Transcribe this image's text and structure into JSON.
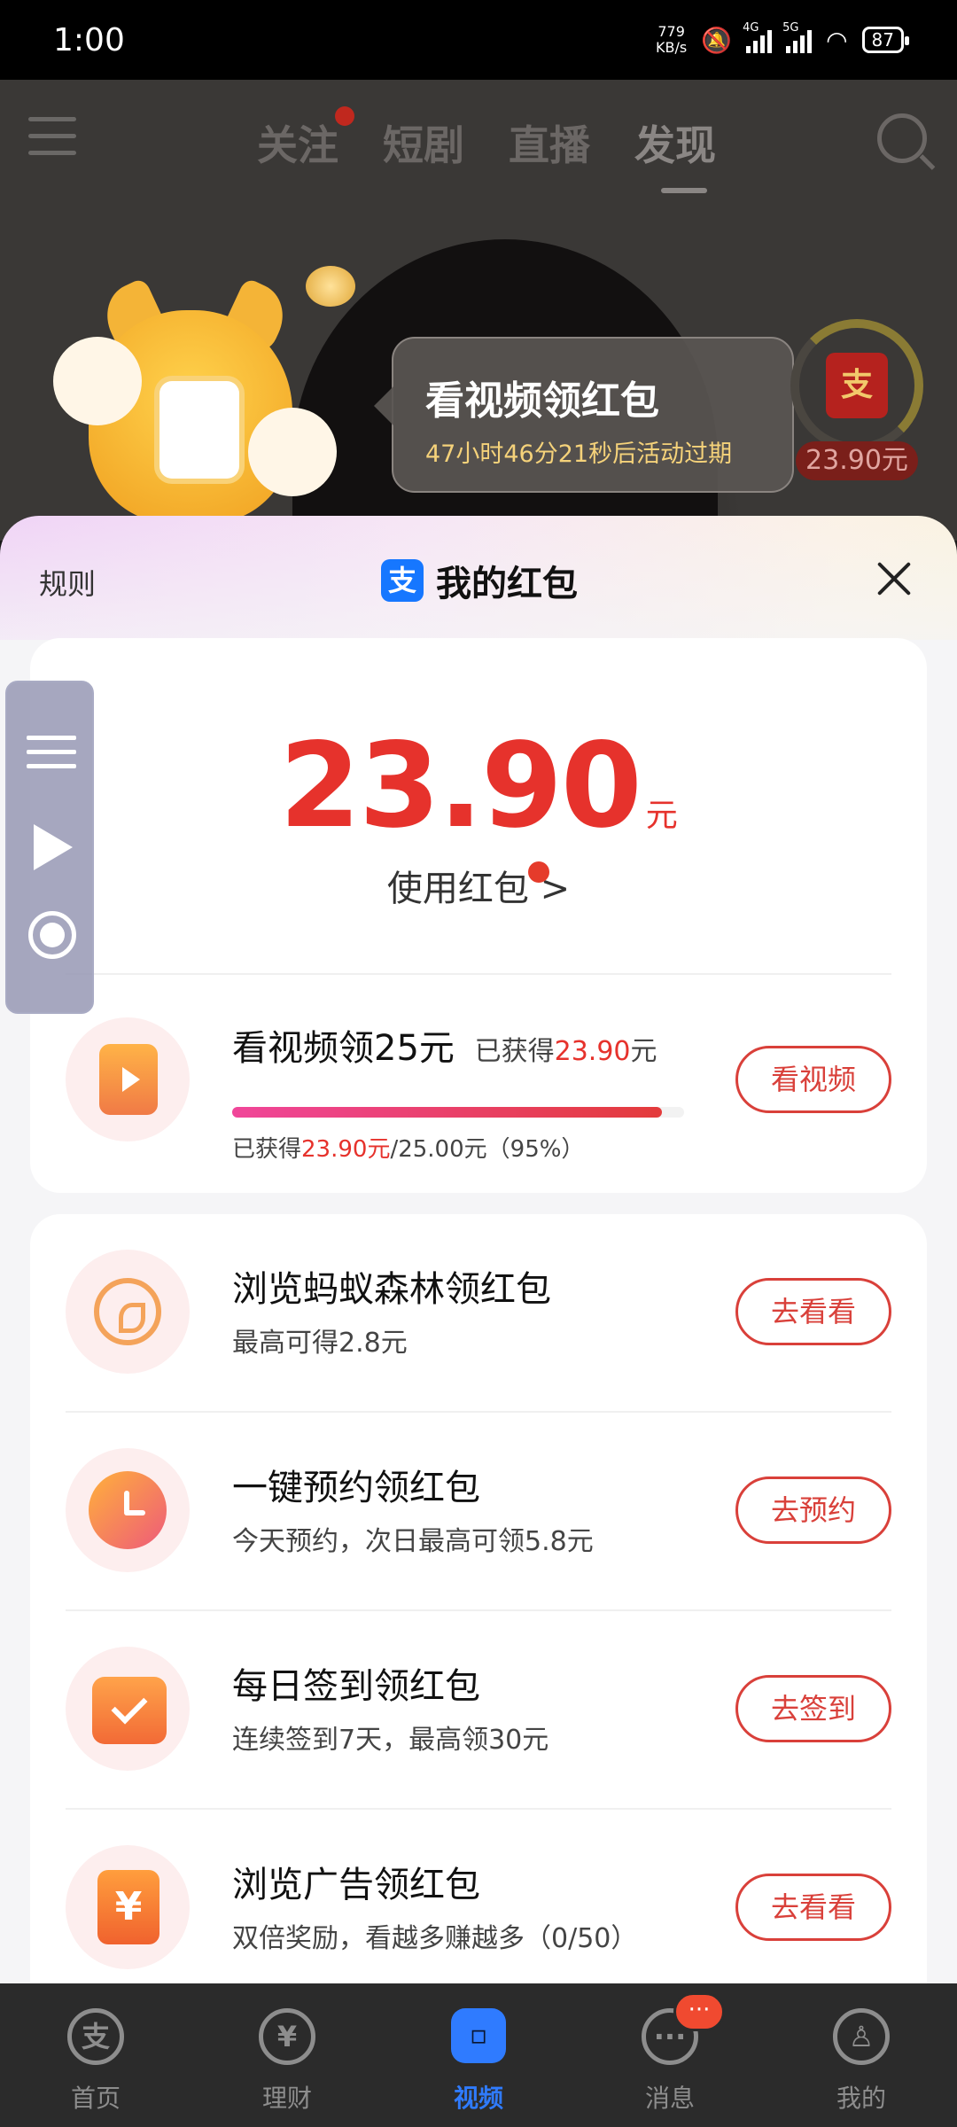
{
  "status_bar": {
    "time": "1:00",
    "net_speed_value": "779",
    "net_speed_unit": "KB/s",
    "signal1_tag": "4G",
    "signal2_tag": "5G",
    "battery": "87"
  },
  "top_nav": {
    "tabs": [
      {
        "label": "关注"
      },
      {
        "label": "短剧"
      },
      {
        "label": "直播"
      },
      {
        "label": "发现"
      }
    ]
  },
  "promo": {
    "title": "看视频领红包",
    "countdown": "47小时46分21秒后活动过期",
    "redpack_glyph": "支",
    "redpack_amount": "23.90元"
  },
  "sheet": {
    "rules_label": "规则",
    "logo_glyph": "支",
    "title": "我的红包",
    "balance": "23.90",
    "balance_unit": "元",
    "use_label": "使用红包 >",
    "watch_task": {
      "title": "看视频领25元",
      "earned_prefix": "已获得",
      "earned_amount": "23.90",
      "earned_unit": "元",
      "progress_prefix": "已获得",
      "progress_amount": "23.90元",
      "progress_total": "/25.00元（95%）",
      "progress_fraction": 0.95,
      "button": "看视频"
    },
    "tasks": [
      {
        "title": "浏览蚂蚁森林领红包",
        "subtitle": "最高可得2.8元",
        "button": "去看看",
        "icon": "sprout-icon"
      },
      {
        "title": "一键预约领红包",
        "subtitle": "今天预约，次日最高可领5.8元",
        "button": "去预约",
        "icon": "clock-icon"
      },
      {
        "title": "每日签到领红包",
        "subtitle": "连续签到7天，最高领30元",
        "button": "去签到",
        "icon": "calendar-check-icon"
      },
      {
        "title": "浏览广告领红包",
        "subtitle": "双倍奖励，看越多赚越多（0/50）",
        "button": "去看看",
        "icon": "yen-icon",
        "icon_glyph": "¥"
      }
    ]
  },
  "bottom_nav": {
    "items": [
      {
        "label": "首页",
        "icon_glyph": "支"
      },
      {
        "label": "理财",
        "icon_glyph": "¥"
      },
      {
        "label": "视频",
        "icon_glyph": "▫"
      },
      {
        "label": "消息",
        "icon_glyph": "···",
        "badge": "···"
      },
      {
        "label": "我的",
        "icon_glyph": "♙"
      }
    ]
  },
  "colors": {
    "accent_red": "#e6322c",
    "alipay_blue": "#1677ff",
    "nav_active": "#2f7bff"
  }
}
